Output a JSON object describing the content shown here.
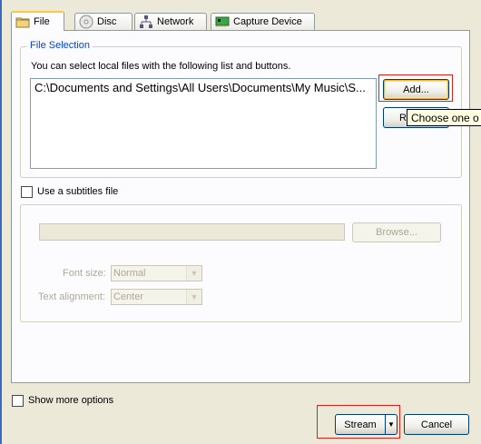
{
  "tabs": [
    {
      "label": "File",
      "icon": "folder-icon",
      "active": true
    },
    {
      "label": "Disc",
      "icon": "disc-icon",
      "active": false
    },
    {
      "label": "Network",
      "icon": "network-icon",
      "active": false
    },
    {
      "label": "Capture Device",
      "icon": "capture-card-icon",
      "active": false
    }
  ],
  "file_selection": {
    "title": "File Selection",
    "hint": "You can select local files with the following list and buttons.",
    "files": [
      "C:\\Documents and Settings\\All Users\\Documents\\My Music\\S..."
    ],
    "add_label": "Add...",
    "remove_label": "R",
    "tooltip": "Choose one o"
  },
  "subtitles": {
    "checkbox_label": "Use a subtitles file",
    "checked": false,
    "path_value": "",
    "browse_label": "Browse...",
    "font_size_label": "Font size:",
    "font_size_value": "Normal",
    "alignment_label": "Text alignment:",
    "alignment_value": "Center"
  },
  "footer": {
    "show_more_label": "Show more options",
    "stream_label": "Stream",
    "cancel_label": "Cancel"
  },
  "colors": {
    "window_bg": "#ECE9D8",
    "panel_bg": "#FCFCFE",
    "group_title": "#0046D5",
    "highlight_box": "#E0201B",
    "tooltip_bg": "#FFFFE1"
  }
}
